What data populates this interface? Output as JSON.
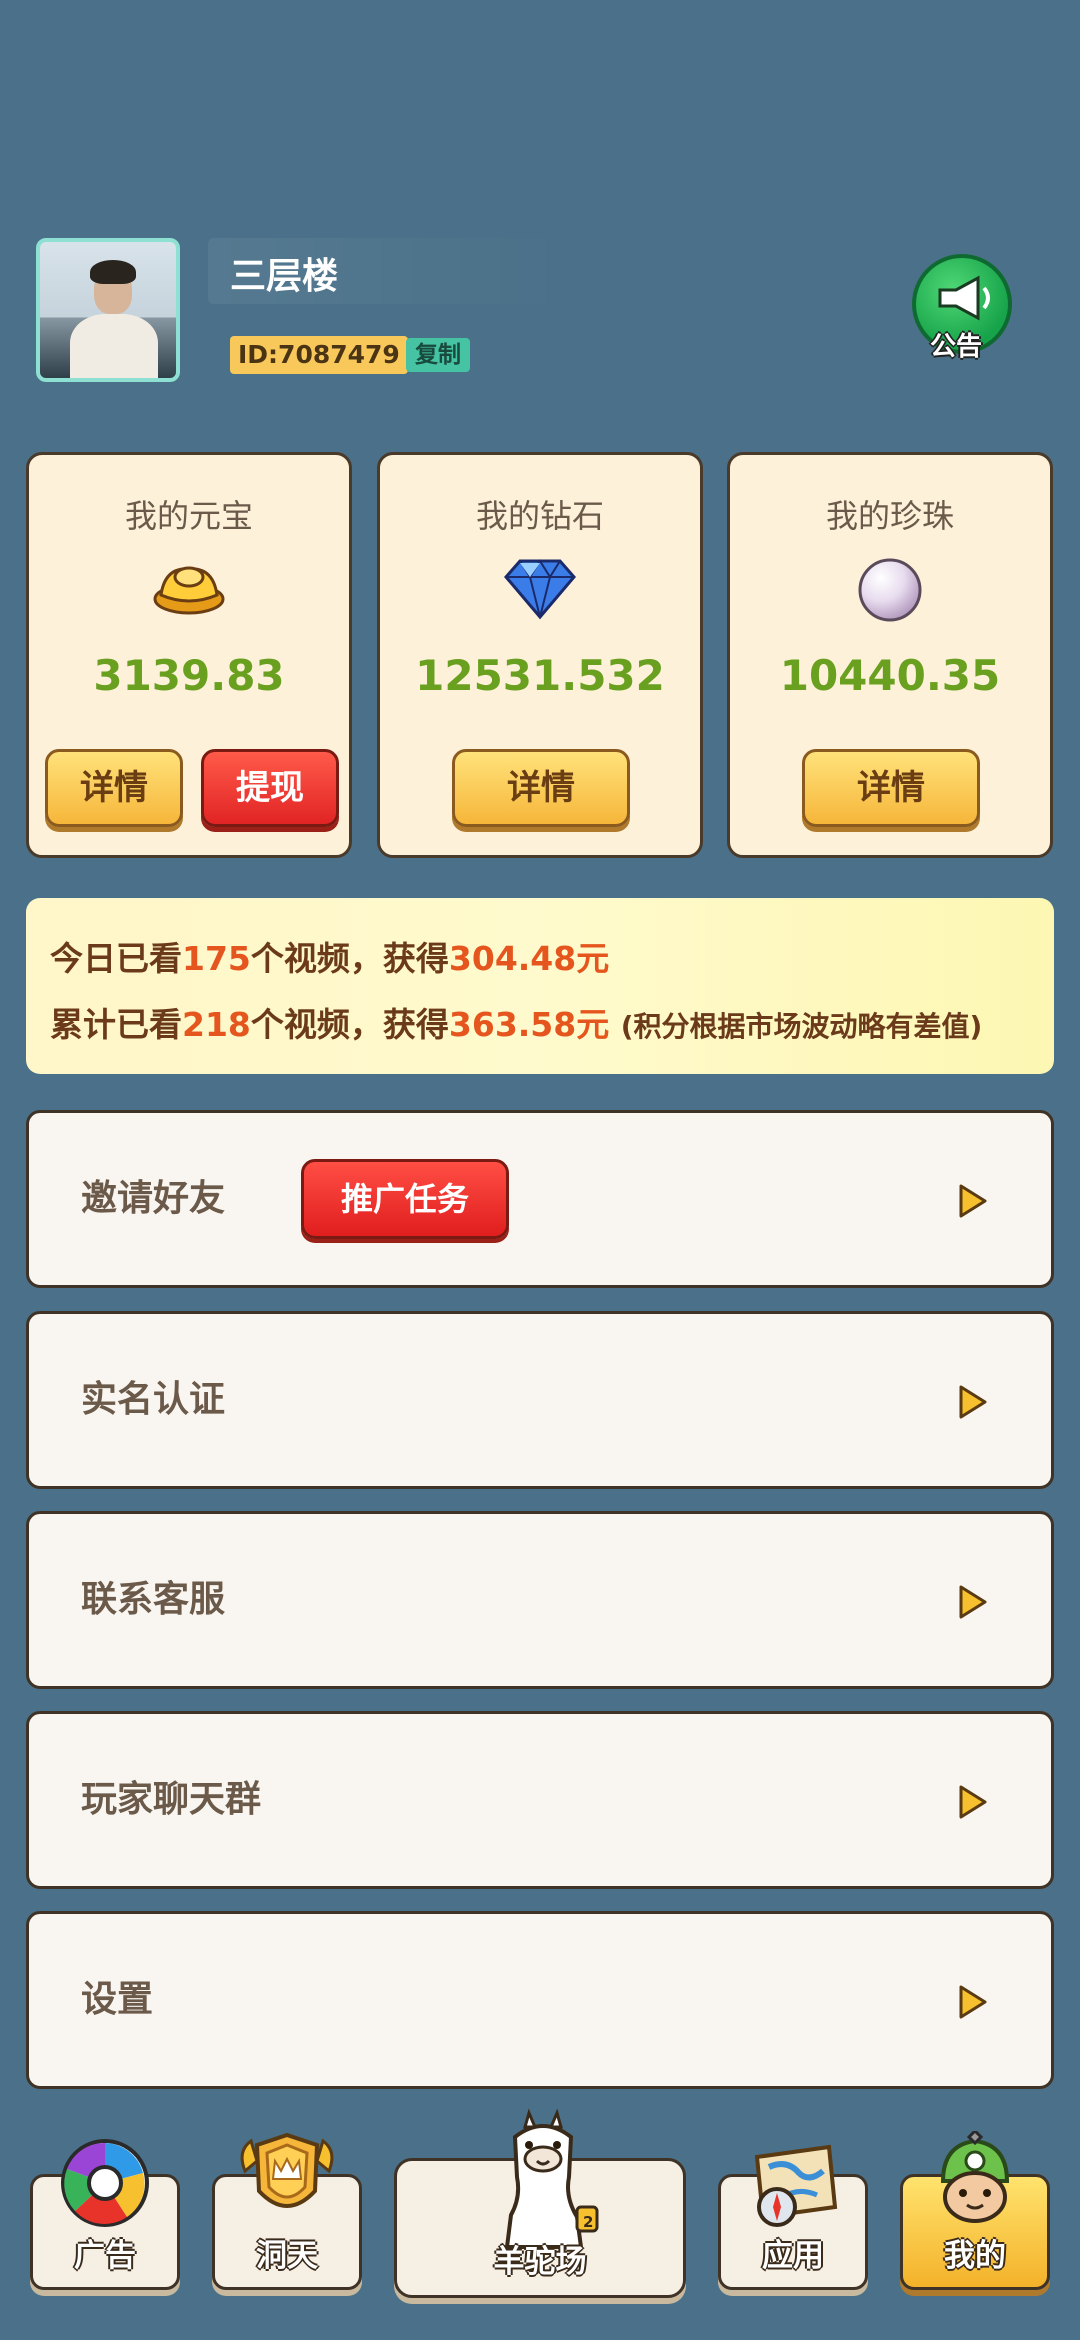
{
  "user": {
    "name": "三层楼",
    "id_text": "ID:7087479",
    "copy_label": "复制"
  },
  "notice": {
    "label": "公告",
    "icon": "megaphone-icon"
  },
  "cards": [
    {
      "title": "我的元宝",
      "value": "3139.83",
      "icon": "gold-ingot-icon",
      "detail_label": "详情",
      "withdraw_label": "提现"
    },
    {
      "title": "我的钻石",
      "value": "12531.532",
      "icon": "diamond-icon",
      "detail_label": "详情"
    },
    {
      "title": "我的珍珠",
      "value": "10440.35",
      "icon": "pearl-icon",
      "detail_label": "详情"
    }
  ],
  "stats": {
    "today_prefix": "今日已看",
    "today_count": "175",
    "today_mid": "个视频，获得",
    "today_amount": "304.48元",
    "total_prefix": "累计已看",
    "total_count": "218",
    "total_mid": "个视频，获得",
    "total_amount": "363.58元",
    "note": "(积分根据市场波动略有差值)"
  },
  "menu": {
    "invite": "邀请好友",
    "promo_label": "推广任务",
    "verify": "实名认证",
    "service": "联系客服",
    "chat": "玩家聊天群",
    "settings": "设置"
  },
  "nav": {
    "ads": "广告",
    "cave": "洞天",
    "alpaca": "羊驼场",
    "alpaca_badge": "2",
    "apps": "应用",
    "mine": "我的"
  },
  "colors": {
    "background": "#4a7189",
    "value_green": "#6aa01f",
    "highlight_orange": "#e5561e",
    "button_yellow": "#f6b63a",
    "button_red": "#e12424"
  }
}
